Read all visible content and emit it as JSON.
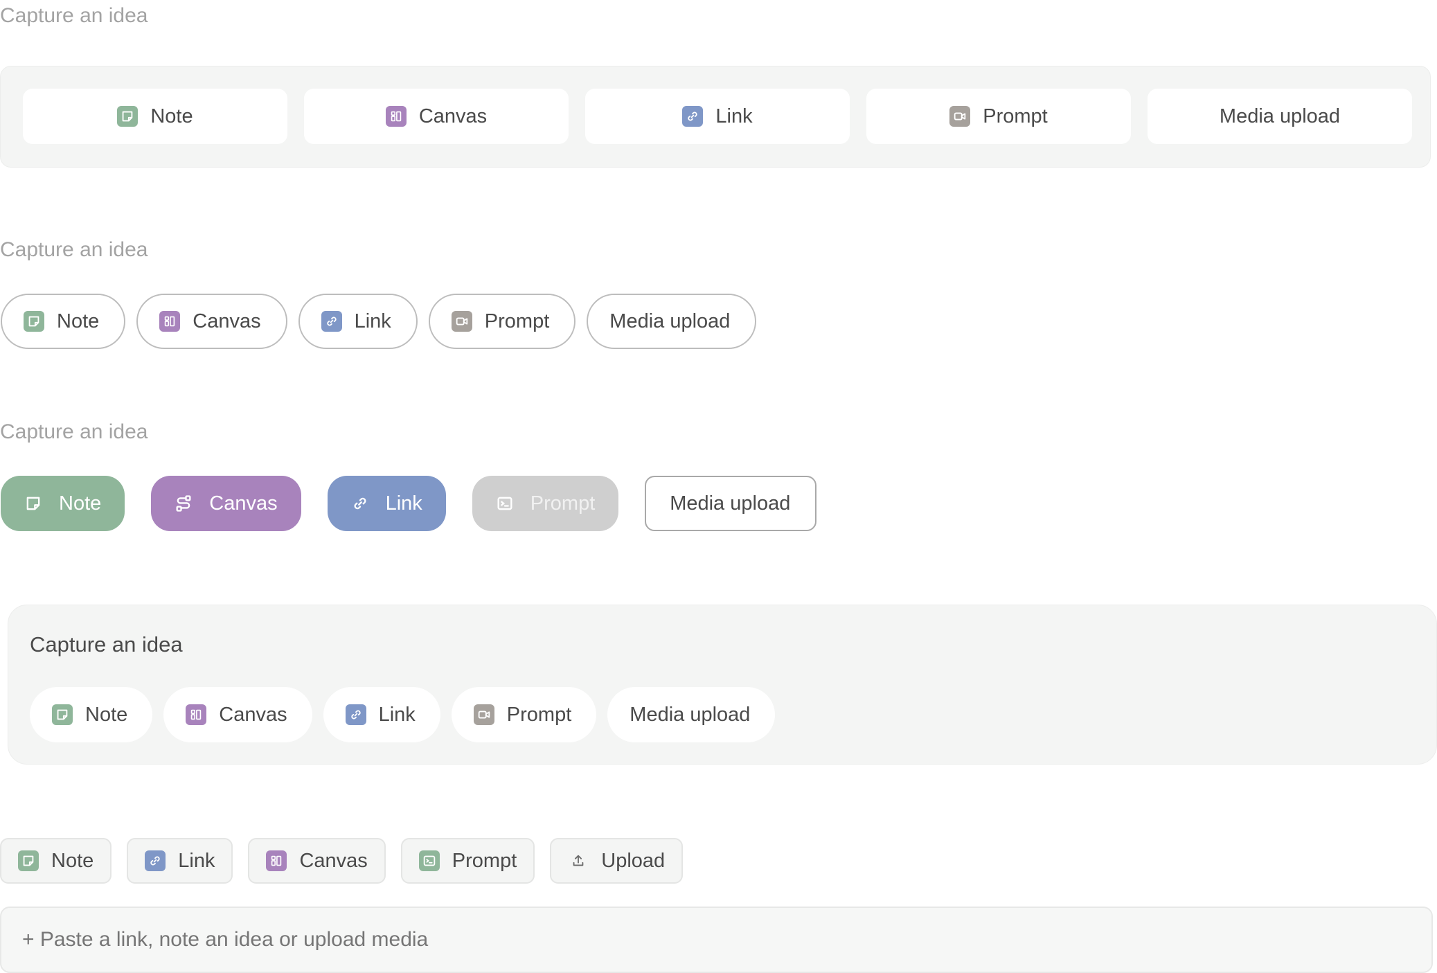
{
  "colors": {
    "note": "#8fb69a",
    "canvas": "#a883bc",
    "link": "#7f97c7",
    "prompt": "#a6a19c",
    "prompt_disabled": "#cfcfcf",
    "panel": "#f4f5f4"
  },
  "variant1": {
    "heading": "Capture an idea",
    "buttons": [
      {
        "label": "Note",
        "icon": "note-icon"
      },
      {
        "label": "Canvas",
        "icon": "canvas-icon"
      },
      {
        "label": "Link",
        "icon": "link-icon"
      },
      {
        "label": "Prompt",
        "icon": "video-icon"
      },
      {
        "label": "Media upload",
        "icon": ""
      }
    ]
  },
  "variant2": {
    "heading": "Capture an idea",
    "buttons": [
      {
        "label": "Note",
        "icon": "note-icon"
      },
      {
        "label": "Canvas",
        "icon": "canvas-icon"
      },
      {
        "label": "Link",
        "icon": "link-icon"
      },
      {
        "label": "Prompt",
        "icon": "video-icon"
      },
      {
        "label": "Media upload",
        "icon": ""
      }
    ]
  },
  "variant3": {
    "heading": "Capture an idea",
    "buttons": [
      {
        "label": "Note",
        "icon": "note-icon"
      },
      {
        "label": "Canvas",
        "icon": "flow-icon"
      },
      {
        "label": "Link",
        "icon": "link-icon"
      },
      {
        "label": "Prompt",
        "icon": "terminal-icon",
        "state": "disabled"
      },
      {
        "label": "Media upload",
        "icon": ""
      }
    ]
  },
  "variant4": {
    "heading": "Capture an idea",
    "buttons": [
      {
        "label": "Note",
        "icon": "note-icon"
      },
      {
        "label": "Canvas",
        "icon": "canvas-icon"
      },
      {
        "label": "Link",
        "icon": "link-icon"
      },
      {
        "label": "Prompt",
        "icon": "video-icon"
      },
      {
        "label": "Media upload",
        "icon": ""
      }
    ]
  },
  "variant5": {
    "buttons": [
      {
        "label": "Note",
        "icon": "note-icon"
      },
      {
        "label": "Link",
        "icon": "link-icon"
      },
      {
        "label": "Canvas",
        "icon": "canvas-icon"
      },
      {
        "label": "Prompt",
        "icon": "terminal-icon"
      },
      {
        "label": "Upload",
        "icon": "upload-icon"
      }
    ],
    "input_placeholder": "+ Paste a link, note an idea or upload media"
  }
}
